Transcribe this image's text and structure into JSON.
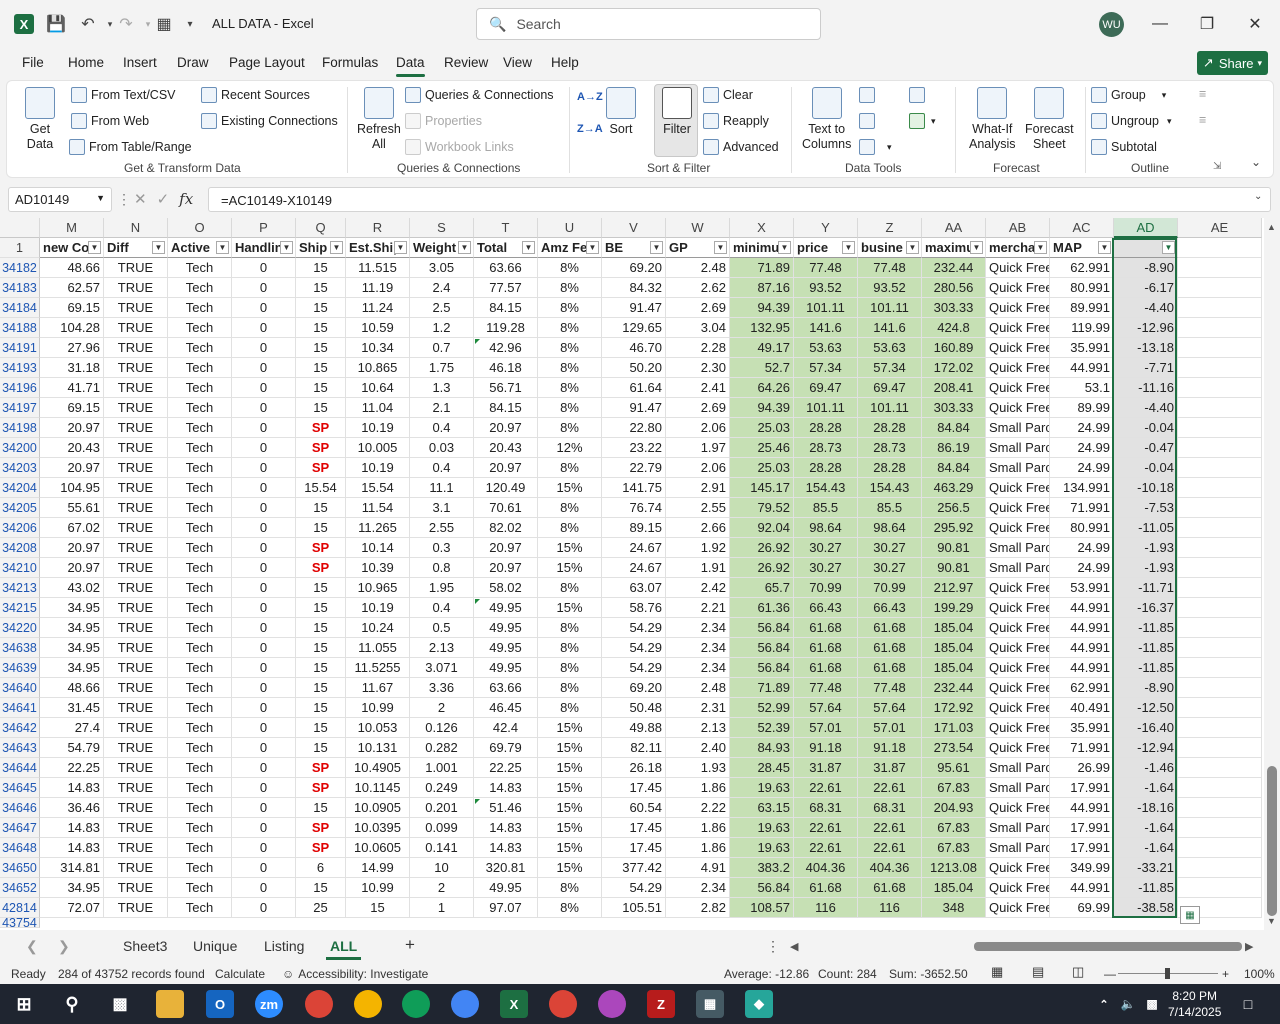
{
  "title": {
    "app_title": "ALL DATA  -  Excel",
    "search_placeholder": "Search",
    "avatar_initials": "WU"
  },
  "menu": {
    "items": [
      "File",
      "Home",
      "Insert",
      "Draw",
      "Page Layout",
      "Formulas",
      "Data",
      "Review",
      "View",
      "Help"
    ],
    "active": "Data",
    "share_label": "Share"
  },
  "ribbon": {
    "get_data": "Get\nData",
    "from_text_csv": "From Text/CSV",
    "from_web": "From Web",
    "from_table_range": "From Table/Range",
    "recent_sources": "Recent Sources",
    "existing_connections": "Existing Connections",
    "group_get_transform": "Get & Transform Data",
    "refresh_all": "Refresh\nAll",
    "queries_connections": "Queries & Connections",
    "properties": "Properties",
    "workbook_links": "Workbook Links",
    "group_queries": "Queries & Connections",
    "sort_az": "A→Z",
    "sort_za": "Z→A",
    "sort": "Sort",
    "filter": "Filter",
    "clear": "Clear",
    "reapply": "Reapply",
    "advanced": "Advanced",
    "group_sort_filter": "Sort & Filter",
    "text_to_columns": "Text to\nColumns",
    "group_data_tools": "Data Tools",
    "what_if": "What-If\nAnalysis",
    "forecast_sheet": "Forecast\nSheet",
    "group_forecast": "Forecast",
    "group": "Group",
    "ungroup": "Ungroup",
    "subtotal": "Subtotal",
    "group_outline": "Outline"
  },
  "formula_bar": {
    "name_box": "AD10149",
    "fx": "fx",
    "formula": "=AC10149-X10149"
  },
  "grid": {
    "columns": [
      "M",
      "N",
      "O",
      "P",
      "Q",
      "R",
      "S",
      "T",
      "U",
      "V",
      "W",
      "X",
      "Y",
      "Z",
      "AA",
      "AB",
      "AC",
      "AD",
      "AE"
    ],
    "headers": [
      "new Co",
      "Diff",
      "Active",
      "Handlin",
      "Ship",
      "Est.Ship",
      "Weight",
      "Total",
      "Amz Fe",
      "BE",
      "GP",
      "minimu",
      "price",
      "busine",
      "maximu",
      "mercha",
      "MAP",
      ""
    ],
    "header_row_number": "1",
    "rows": [
      {
        "rn": "34182",
        "c": [
          "48.66",
          "TRUE",
          "Tech",
          "0",
          "15",
          "11.515",
          "3.05",
          "63.66",
          "8%",
          "69.20",
          "2.48",
          "71.89",
          "77.48",
          "77.48",
          "232.44",
          "Quick Free",
          "62.991",
          "-8.90"
        ]
      },
      {
        "rn": "34183",
        "c": [
          "62.57",
          "TRUE",
          "Tech",
          "0",
          "15",
          "11.19",
          "2.4",
          "77.57",
          "8%",
          "84.32",
          "2.62",
          "87.16",
          "93.52",
          "93.52",
          "280.56",
          "Quick Free",
          "80.991",
          "-6.17"
        ]
      },
      {
        "rn": "34184",
        "c": [
          "69.15",
          "TRUE",
          "Tech",
          "0",
          "15",
          "11.24",
          "2.5",
          "84.15",
          "8%",
          "91.47",
          "2.69",
          "94.39",
          "101.11",
          "101.11",
          "303.33",
          "Quick Free",
          "89.991",
          "-4.40"
        ]
      },
      {
        "rn": "34188",
        "c": [
          "104.28",
          "TRUE",
          "Tech",
          "0",
          "15",
          "10.59",
          "1.2",
          "119.28",
          "8%",
          "129.65",
          "3.04",
          "132.95",
          "141.6",
          "141.6",
          "424.8",
          "Quick Free",
          "119.99",
          "-12.96"
        ]
      },
      {
        "rn": "34191",
        "c": [
          "27.96",
          "TRUE",
          "Tech",
          "0",
          "15",
          "10.34",
          "0.7",
          "42.96",
          "8%",
          "46.70",
          "2.28",
          "49.17",
          "53.63",
          "53.63",
          "160.89",
          "Quick Free",
          "35.991",
          "-13.18"
        ]
      },
      {
        "rn": "34193",
        "c": [
          "31.18",
          "TRUE",
          "Tech",
          "0",
          "15",
          "10.865",
          "1.75",
          "46.18",
          "8%",
          "50.20",
          "2.30",
          "52.7",
          "57.34",
          "57.34",
          "172.02",
          "Quick Free",
          "44.991",
          "-7.71"
        ]
      },
      {
        "rn": "34196",
        "c": [
          "41.71",
          "TRUE",
          "Tech",
          "0",
          "15",
          "10.64",
          "1.3",
          "56.71",
          "8%",
          "61.64",
          "2.41",
          "64.26",
          "69.47",
          "69.47",
          "208.41",
          "Quick Free",
          "53.1",
          "-11.16"
        ]
      },
      {
        "rn": "34197",
        "c": [
          "69.15",
          "TRUE",
          "Tech",
          "0",
          "15",
          "11.04",
          "2.1",
          "84.15",
          "8%",
          "91.47",
          "2.69",
          "94.39",
          "101.11",
          "101.11",
          "303.33",
          "Quick Free",
          "89.99",
          "-4.40"
        ]
      },
      {
        "rn": "34198",
        "c": [
          "20.97",
          "TRUE",
          "Tech",
          "0",
          "SP",
          "10.19",
          "0.4",
          "20.97",
          "8%",
          "22.80",
          "2.06",
          "25.03",
          "28.28",
          "28.28",
          "84.84",
          "Small Parc",
          "24.99",
          "-0.04"
        ]
      },
      {
        "rn": "34200",
        "c": [
          "20.43",
          "TRUE",
          "Tech",
          "0",
          "SP",
          "10.005",
          "0.03",
          "20.43",
          "12%",
          "23.22",
          "1.97",
          "25.46",
          "28.73",
          "28.73",
          "86.19",
          "Small Parc",
          "24.99",
          "-0.47"
        ]
      },
      {
        "rn": "34203",
        "c": [
          "20.97",
          "TRUE",
          "Tech",
          "0",
          "SP",
          "10.19",
          "0.4",
          "20.97",
          "8%",
          "22.79",
          "2.06",
          "25.03",
          "28.28",
          "28.28",
          "84.84",
          "Small Parc",
          "24.99",
          "-0.04"
        ]
      },
      {
        "rn": "34204",
        "c": [
          "104.95",
          "TRUE",
          "Tech",
          "0",
          "15.54",
          "15.54",
          "11.1",
          "120.49",
          "15%",
          "141.75",
          "2.91",
          "145.17",
          "154.43",
          "154.43",
          "463.29",
          "Quick Free",
          "134.991",
          "-10.18"
        ]
      },
      {
        "rn": "34205",
        "c": [
          "55.61",
          "TRUE",
          "Tech",
          "0",
          "15",
          "11.54",
          "3.1",
          "70.61",
          "8%",
          "76.74",
          "2.55",
          "79.52",
          "85.5",
          "85.5",
          "256.5",
          "Quick Free",
          "71.991",
          "-7.53"
        ]
      },
      {
        "rn": "34206",
        "c": [
          "67.02",
          "TRUE",
          "Tech",
          "0",
          "15",
          "11.265",
          "2.55",
          "82.02",
          "8%",
          "89.15",
          "2.66",
          "92.04",
          "98.64",
          "98.64",
          "295.92",
          "Quick Free",
          "80.991",
          "-11.05"
        ]
      },
      {
        "rn": "34208",
        "c": [
          "20.97",
          "TRUE",
          "Tech",
          "0",
          "SP",
          "10.14",
          "0.3",
          "20.97",
          "15%",
          "24.67",
          "1.92",
          "26.92",
          "30.27",
          "30.27",
          "90.81",
          "Small Parc",
          "24.99",
          "-1.93"
        ]
      },
      {
        "rn": "34210",
        "c": [
          "20.97",
          "TRUE",
          "Tech",
          "0",
          "SP",
          "10.39",
          "0.8",
          "20.97",
          "15%",
          "24.67",
          "1.91",
          "26.92",
          "30.27",
          "30.27",
          "90.81",
          "Small Parc",
          "24.99",
          "-1.93"
        ]
      },
      {
        "rn": "34213",
        "c": [
          "43.02",
          "TRUE",
          "Tech",
          "0",
          "15",
          "10.965",
          "1.95",
          "58.02",
          "8%",
          "63.07",
          "2.42",
          "65.7",
          "70.99",
          "70.99",
          "212.97",
          "Quick Free",
          "53.991",
          "-11.71"
        ]
      },
      {
        "rn": "34215",
        "c": [
          "34.95",
          "TRUE",
          "Tech",
          "0",
          "15",
          "10.19",
          "0.4",
          "49.95",
          "15%",
          "58.76",
          "2.21",
          "61.36",
          "66.43",
          "66.43",
          "199.29",
          "Quick Free",
          "44.991",
          "-16.37"
        ]
      },
      {
        "rn": "34220",
        "c": [
          "34.95",
          "TRUE",
          "Tech",
          "0",
          "15",
          "10.24",
          "0.5",
          "49.95",
          "8%",
          "54.29",
          "2.34",
          "56.84",
          "61.68",
          "61.68",
          "185.04",
          "Quick Free",
          "44.991",
          "-11.85"
        ]
      },
      {
        "rn": "34638",
        "c": [
          "34.95",
          "TRUE",
          "Tech",
          "0",
          "15",
          "11.055",
          "2.13",
          "49.95",
          "8%",
          "54.29",
          "2.34",
          "56.84",
          "61.68",
          "61.68",
          "185.04",
          "Quick Free",
          "44.991",
          "-11.85"
        ]
      },
      {
        "rn": "34639",
        "c": [
          "34.95",
          "TRUE",
          "Tech",
          "0",
          "15",
          "11.5255",
          "3.071",
          "49.95",
          "8%",
          "54.29",
          "2.34",
          "56.84",
          "61.68",
          "61.68",
          "185.04",
          "Quick Free",
          "44.991",
          "-11.85"
        ]
      },
      {
        "rn": "34640",
        "c": [
          "48.66",
          "TRUE",
          "Tech",
          "0",
          "15",
          "11.67",
          "3.36",
          "63.66",
          "8%",
          "69.20",
          "2.48",
          "71.89",
          "77.48",
          "77.48",
          "232.44",
          "Quick Free",
          "62.991",
          "-8.90"
        ]
      },
      {
        "rn": "34641",
        "c": [
          "31.45",
          "TRUE",
          "Tech",
          "0",
          "15",
          "10.99",
          "2",
          "46.45",
          "8%",
          "50.48",
          "2.31",
          "52.99",
          "57.64",
          "57.64",
          "172.92",
          "Quick Free",
          "40.491",
          "-12.50"
        ]
      },
      {
        "rn": "34642",
        "c": [
          "27.4",
          "TRUE",
          "Tech",
          "0",
          "15",
          "10.053",
          "0.126",
          "42.4",
          "15%",
          "49.88",
          "2.13",
          "52.39",
          "57.01",
          "57.01",
          "171.03",
          "Quick Free",
          "35.991",
          "-16.40"
        ]
      },
      {
        "rn": "34643",
        "c": [
          "54.79",
          "TRUE",
          "Tech",
          "0",
          "15",
          "10.131",
          "0.282",
          "69.79",
          "15%",
          "82.11",
          "2.40",
          "84.93",
          "91.18",
          "91.18",
          "273.54",
          "Quick Free",
          "71.991",
          "-12.94"
        ]
      },
      {
        "rn": "34644",
        "c": [
          "22.25",
          "TRUE",
          "Tech",
          "0",
          "SP",
          "10.4905",
          "1.001",
          "22.25",
          "15%",
          "26.18",
          "1.93",
          "28.45",
          "31.87",
          "31.87",
          "95.61",
          "Small Parc",
          "26.99",
          "-1.46"
        ]
      },
      {
        "rn": "34645",
        "c": [
          "14.83",
          "TRUE",
          "Tech",
          "0",
          "SP",
          "10.1145",
          "0.249",
          "14.83",
          "15%",
          "17.45",
          "1.86",
          "19.63",
          "22.61",
          "22.61",
          "67.83",
          "Small Parc",
          "17.991",
          "-1.64"
        ]
      },
      {
        "rn": "34646",
        "c": [
          "36.46",
          "TRUE",
          "Tech",
          "0",
          "15",
          "10.0905",
          "0.201",
          "51.46",
          "15%",
          "60.54",
          "2.22",
          "63.15",
          "68.31",
          "68.31",
          "204.93",
          "Quick Free",
          "44.991",
          "-18.16"
        ]
      },
      {
        "rn": "34647",
        "c": [
          "14.83",
          "TRUE",
          "Tech",
          "0",
          "SP",
          "10.0395",
          "0.099",
          "14.83",
          "15%",
          "17.45",
          "1.86",
          "19.63",
          "22.61",
          "22.61",
          "67.83",
          "Small Parc",
          "17.991",
          "-1.64"
        ]
      },
      {
        "rn": "34648",
        "c": [
          "14.83",
          "TRUE",
          "Tech",
          "0",
          "SP",
          "10.0605",
          "0.141",
          "14.83",
          "15%",
          "17.45",
          "1.86",
          "19.63",
          "22.61",
          "22.61",
          "67.83",
          "Small Parc",
          "17.991",
          "-1.64"
        ]
      },
      {
        "rn": "34650",
        "c": [
          "314.81",
          "TRUE",
          "Tech",
          "0",
          "6",
          "14.99",
          "10",
          "320.81",
          "15%",
          "377.42",
          "4.91",
          "383.2",
          "404.36",
          "404.36",
          "1213.08",
          "Quick Free",
          "349.99",
          "-33.21"
        ]
      },
      {
        "rn": "34652",
        "c": [
          "34.95",
          "TRUE",
          "Tech",
          "0",
          "15",
          "10.99",
          "2",
          "49.95",
          "8%",
          "54.29",
          "2.34",
          "56.84",
          "61.68",
          "61.68",
          "185.04",
          "Quick Free",
          "44.991",
          "-11.85"
        ]
      },
      {
        "rn": "42814",
        "c": [
          "72.07",
          "TRUE",
          "Tech",
          "0",
          "25",
          "15",
          "1",
          "97.07",
          "8%",
          "105.51",
          "2.82",
          "108.57",
          "116",
          "116",
          "348",
          "Quick Free",
          "69.99",
          "-38.58"
        ]
      }
    ],
    "partial_row_number": "43754"
  },
  "tabs": {
    "items": [
      "Sheet3",
      "Unique",
      "Listing",
      "ALL"
    ],
    "active": "ALL",
    "add": "+"
  },
  "status": {
    "ready": "Ready",
    "records": "284 of 43752 records found",
    "calculate": "Calculate",
    "accessibility": "Accessibility: Investigate",
    "average": "Average: -12.86",
    "count": "Count: 284",
    "sum": "Sum: -3652.50",
    "zoom": "100%"
  },
  "taskbar": {
    "time": "8:20 PM",
    "date": "7/14/2025"
  },
  "colors": {
    "accent": "#1d6f42",
    "green_fill": "#c6e0b4",
    "red_text": "#e00000",
    "row_number_blue": "#1e56b3"
  }
}
